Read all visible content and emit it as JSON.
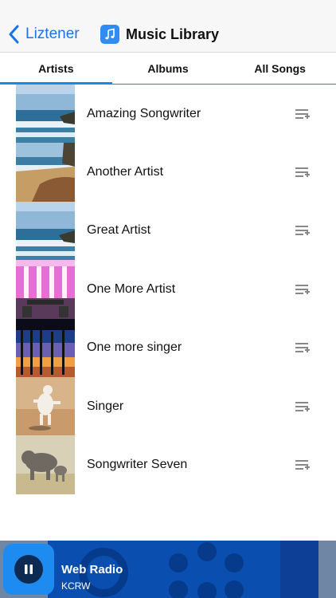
{
  "navbar": {
    "back_label": "Liztener",
    "title": "Music Library"
  },
  "tabs": [
    {
      "label": "Artists",
      "active": true
    },
    {
      "label": "Albums",
      "active": false
    },
    {
      "label": "All Songs",
      "active": false
    }
  ],
  "artists": [
    {
      "name": "Amazing Songwriter",
      "thumb": "ocean-waves"
    },
    {
      "name": "Another Artist",
      "thumb": "rocky-beach"
    },
    {
      "name": "Great Artist",
      "thumb": "ocean-waves"
    },
    {
      "name": "One More Artist",
      "thumb": "pink-stage"
    },
    {
      "name": "One more singer",
      "thumb": "palm-sunset"
    },
    {
      "name": "Singer",
      "thumb": "dancing-dog"
    },
    {
      "name": "Songwriter Seven",
      "thumb": "elephants"
    }
  ],
  "player": {
    "title": "Web Radio",
    "subtitle": "KCRW",
    "state": "playing"
  },
  "colors": {
    "accent": "#1a8ae0",
    "back": "#1a73e8",
    "player_bg": "#0b56b8"
  }
}
